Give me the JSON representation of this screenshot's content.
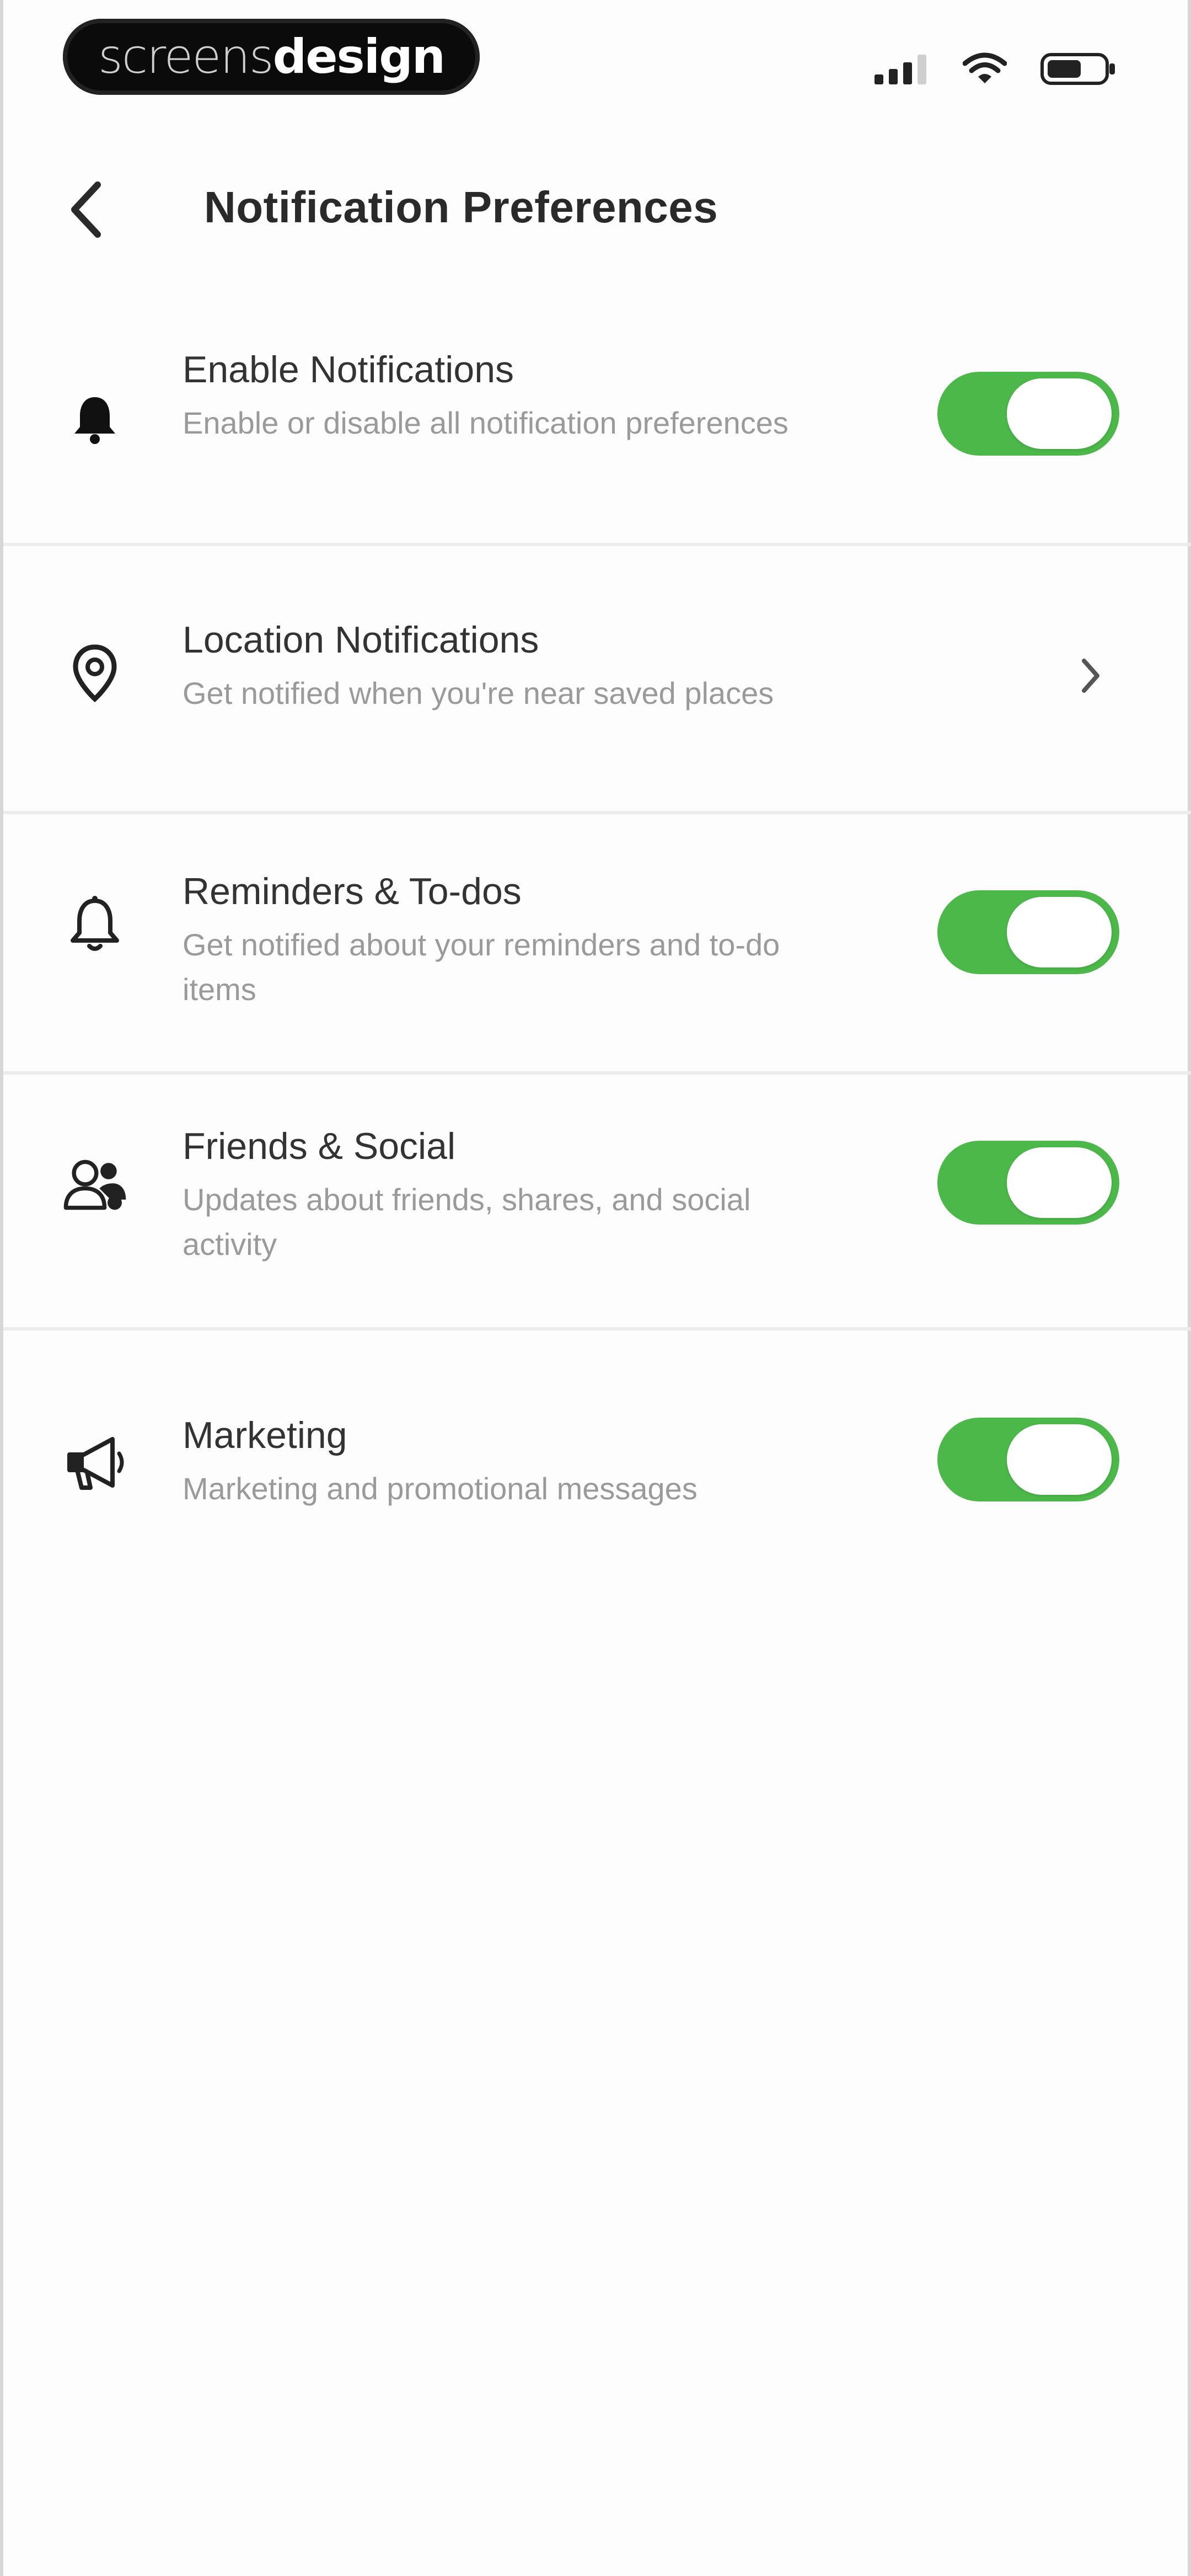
{
  "status_bar": {
    "brand_light": "screens",
    "brand_bold": "design"
  },
  "header": {
    "title": "Notification Preferences"
  },
  "settings": [
    {
      "id": "enable",
      "icon": "bell-filled-icon",
      "title": "Enable Notifications",
      "subtitle": "Enable or disable all notification preferences",
      "control": "toggle",
      "on": true
    },
    {
      "id": "location",
      "icon": "map-pin-icon",
      "title": "Location Notifications",
      "subtitle": "Get notified when you're near saved places",
      "control": "chevron"
    },
    {
      "id": "reminders",
      "icon": "bell-outline-icon",
      "title": "Reminders & To-dos",
      "subtitle": "Get notified about your reminders and to-do items",
      "control": "toggle",
      "on": true
    },
    {
      "id": "friends",
      "icon": "friends-icon",
      "title": "Friends & Social",
      "subtitle": "Updates about friends, shares, and social activity",
      "control": "toggle",
      "on": true
    },
    {
      "id": "marketing",
      "icon": "megaphone-icon",
      "title": "Marketing",
      "subtitle": "Marketing and promotional messages",
      "control": "toggle",
      "on": true
    }
  ],
  "colors": {
    "toggle_on": "#4cb84a",
    "title_text": "#333333",
    "subtitle_text": "#9a9a9a",
    "divider": "#ececec"
  }
}
